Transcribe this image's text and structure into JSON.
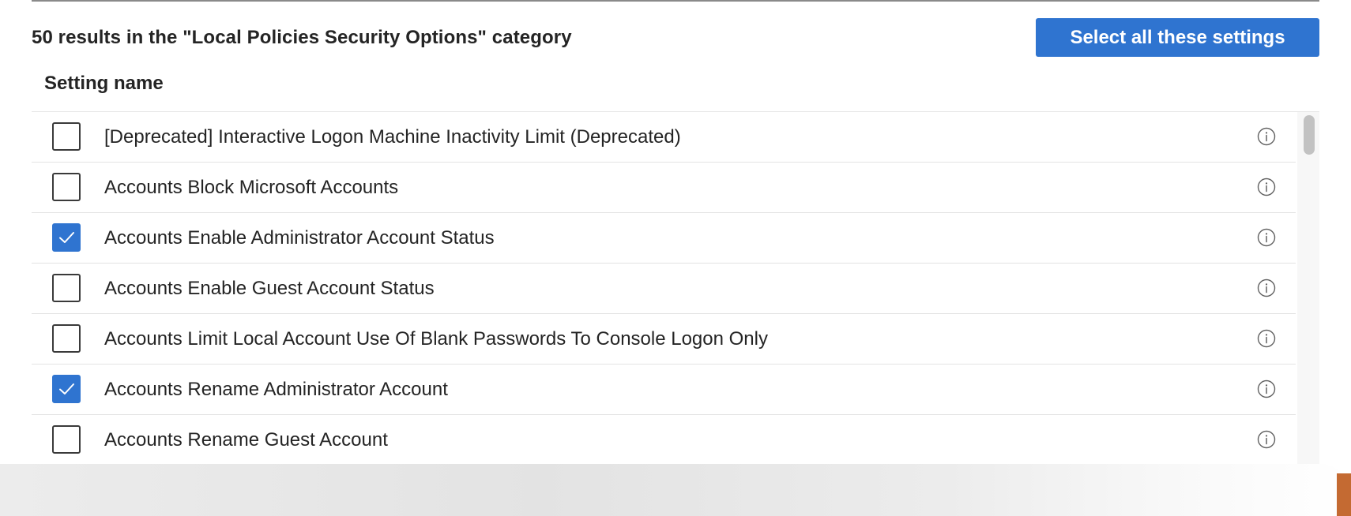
{
  "header": {
    "results_text": "50 results in the \"Local Policies Security Options\" category",
    "select_all_label": "Select all these settings"
  },
  "table": {
    "column_header": "Setting name",
    "rows": [
      {
        "label": "[Deprecated] Interactive Logon Machine Inactivity Limit (Deprecated)",
        "checked": false
      },
      {
        "label": "Accounts Block Microsoft Accounts",
        "checked": false
      },
      {
        "label": "Accounts Enable Administrator Account Status",
        "checked": true
      },
      {
        "label": "Accounts Enable Guest Account Status",
        "checked": false
      },
      {
        "label": "Accounts Limit Local Account Use Of Blank Passwords To Console Logon Only",
        "checked": false
      },
      {
        "label": "Accounts Rename Administrator Account",
        "checked": true
      },
      {
        "label": "Accounts Rename Guest Account",
        "checked": false
      }
    ]
  },
  "colors": {
    "accent": "#2f74d0",
    "text": "#242424",
    "divider": "#e3e3e3"
  },
  "icons": {
    "checkmark": "checkmark-icon",
    "info": "info-icon"
  }
}
